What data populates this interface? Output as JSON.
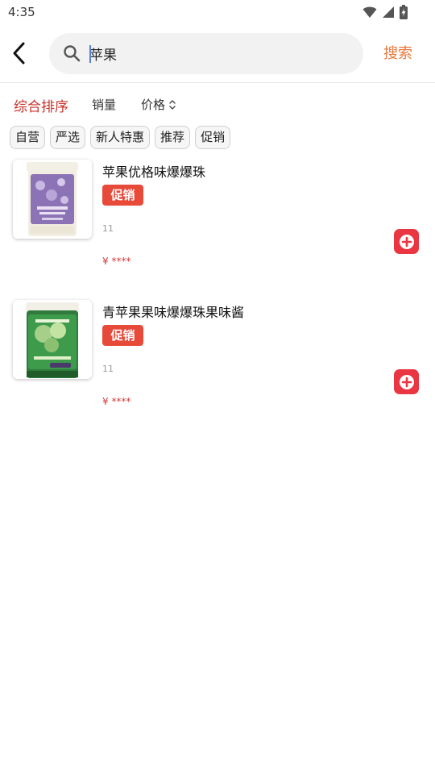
{
  "status_bar": {
    "time": "4:35",
    "icons": [
      "wifi-icon",
      "cell-signal-icon",
      "battery-charging-icon"
    ]
  },
  "header": {
    "search_value": "苹果",
    "search_button_label": "搜索"
  },
  "sort_bar": {
    "items": [
      {
        "label": "综合排序",
        "active": true
      },
      {
        "label": "销量",
        "active": false
      },
      {
        "label": "价格",
        "active": false
      }
    ]
  },
  "tags": [
    "自营",
    "严选",
    "新人特惠",
    "推荐",
    "促销"
  ],
  "products": [
    {
      "name": "苹果优格味爆爆珠",
      "badge": "促销",
      "count": "11",
      "price": "¥ ****"
    },
    {
      "name": "青苹果果味爆爆珠果味酱",
      "badge": "促销",
      "count": "11",
      "price": "¥ ****"
    }
  ],
  "colors": {
    "accent_orange": "#e8773a",
    "active_red": "#c8332d",
    "promo_red": "#e84a3a",
    "add_button_red": "#ea3542",
    "price_red": "#d63a3a"
  }
}
